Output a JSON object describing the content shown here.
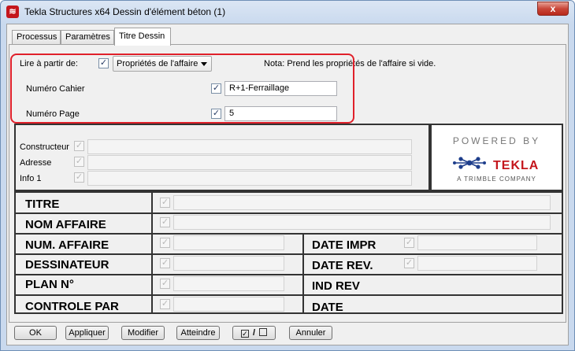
{
  "window": {
    "title": "Tekla Structures x64  Dessin d'élément béton (1)",
    "close_label": "x"
  },
  "tabs": [
    {
      "label": "Processus"
    },
    {
      "label": "Paramètres"
    },
    {
      "label": "Titre Dessin",
      "active": true
    }
  ],
  "read_from": {
    "label": "Lire à partir de:",
    "value": "Propriétés de l'affaire",
    "note": "Nota: Prend les propriétés de l'affaire si vide."
  },
  "fields": {
    "numero_cahier": {
      "label": "Numéro Cahier",
      "value": "R+1-Ferraillage"
    },
    "numero_page": {
      "label": "Numéro Page",
      "value": "5"
    },
    "constructeur": {
      "label": "Constructeur"
    },
    "adresse": {
      "label": "Adresse"
    },
    "info1": {
      "label": "Info 1"
    }
  },
  "logo": {
    "powered": "POWERED BY",
    "brand": "TEKLA",
    "tagline": "A TRIMBLE COMPANY"
  },
  "title_block": {
    "titre": "TITRE",
    "nom_affaire": "NOM AFFAIRE",
    "num_affaire": "NUM. AFFAIRE",
    "dessinateur": "DESSINATEUR",
    "plan_no": "PLAN N°",
    "controle_par": "CONTROLE PAR",
    "date_impr": "DATE IMPR",
    "date_rev": "DATE REV.",
    "ind_rev": "IND REV",
    "date": "DATE"
  },
  "buttons": {
    "ok": "OK",
    "apply": "Appliquer",
    "modify": "Modifier",
    "get": "Atteindre",
    "toggle": "/",
    "cancel": "Annuler"
  },
  "colors": {
    "highlight": "#e0202a",
    "tekla_red": "#c4161c"
  }
}
